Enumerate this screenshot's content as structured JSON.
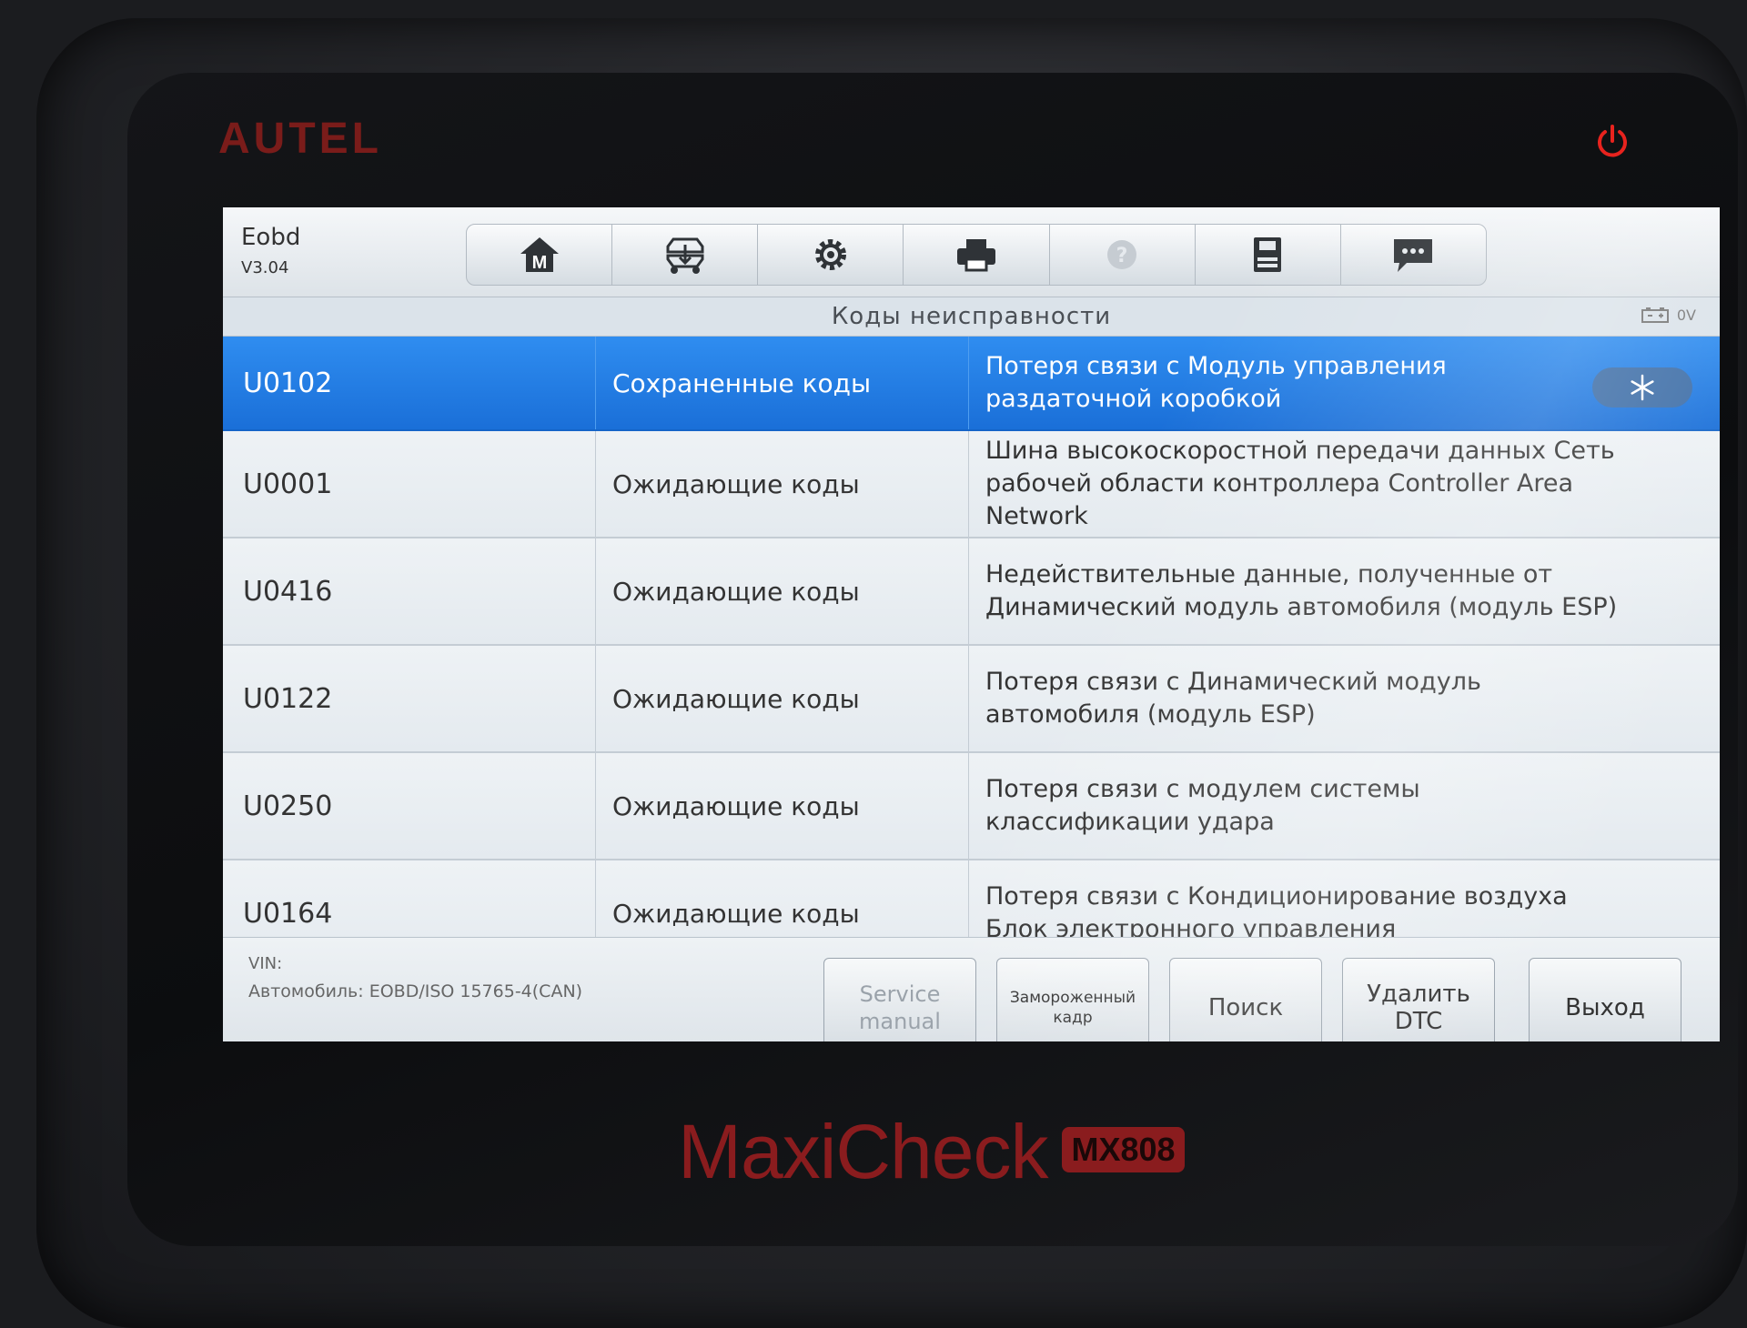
{
  "device": {
    "brand": "AUTEL",
    "model": "MaxiCheck",
    "model_badge": "MX808"
  },
  "app": {
    "name": "Eobd",
    "version": "V3.04"
  },
  "toolbar": {
    "icons": [
      "home-icon",
      "vehicle-swap-icon",
      "settings-gear-icon",
      "print-icon",
      "help-icon",
      "save-icon",
      "message-icon"
    ]
  },
  "page": {
    "title": "Коды неисправности",
    "voltage": "0V"
  },
  "dtcs": [
    {
      "code": "U0102",
      "status": "Сохраненные коды",
      "description": "Потеря связи с Модуль управления раздаточной коробкой",
      "selected": true
    },
    {
      "code": "U0001",
      "status": "Ожидающие коды",
      "description": "Шина высокоскоростной передачи данных Сеть рабочей области контроллера Controller Area Network"
    },
    {
      "code": "U0416",
      "status": "Ожидающие коды",
      "description": "Недействительные данные, полученные от Динамический модуль автомобиля (модуль ESP)"
    },
    {
      "code": "U0122",
      "status": "Ожидающие коды",
      "description": "Потеря связи с Динамический модуль автомобиля (модуль ESP)"
    },
    {
      "code": "U0250",
      "status": "Ожидающие коды",
      "description": "Потеря связи с модулем системы классификации удара"
    },
    {
      "code": "U0164",
      "status": "Ожидающие коды",
      "description": "Потеря связи с  Кондиционирование воздуха Блок электронного управления"
    }
  ],
  "footer": {
    "vin_label": "VIN:",
    "vehicle": "Автомобиль: EOBD/ISO 15765-4(CAN)",
    "buttons": {
      "service_manual": "Service manual",
      "freeze_frame": "Замороженный кадр",
      "search": "Поиск",
      "clear_dtc": "Удалить DTC",
      "exit": "Выход"
    }
  },
  "colors": {
    "selected_row": "#1f78e0",
    "brand_red": "#8a1c1e"
  }
}
